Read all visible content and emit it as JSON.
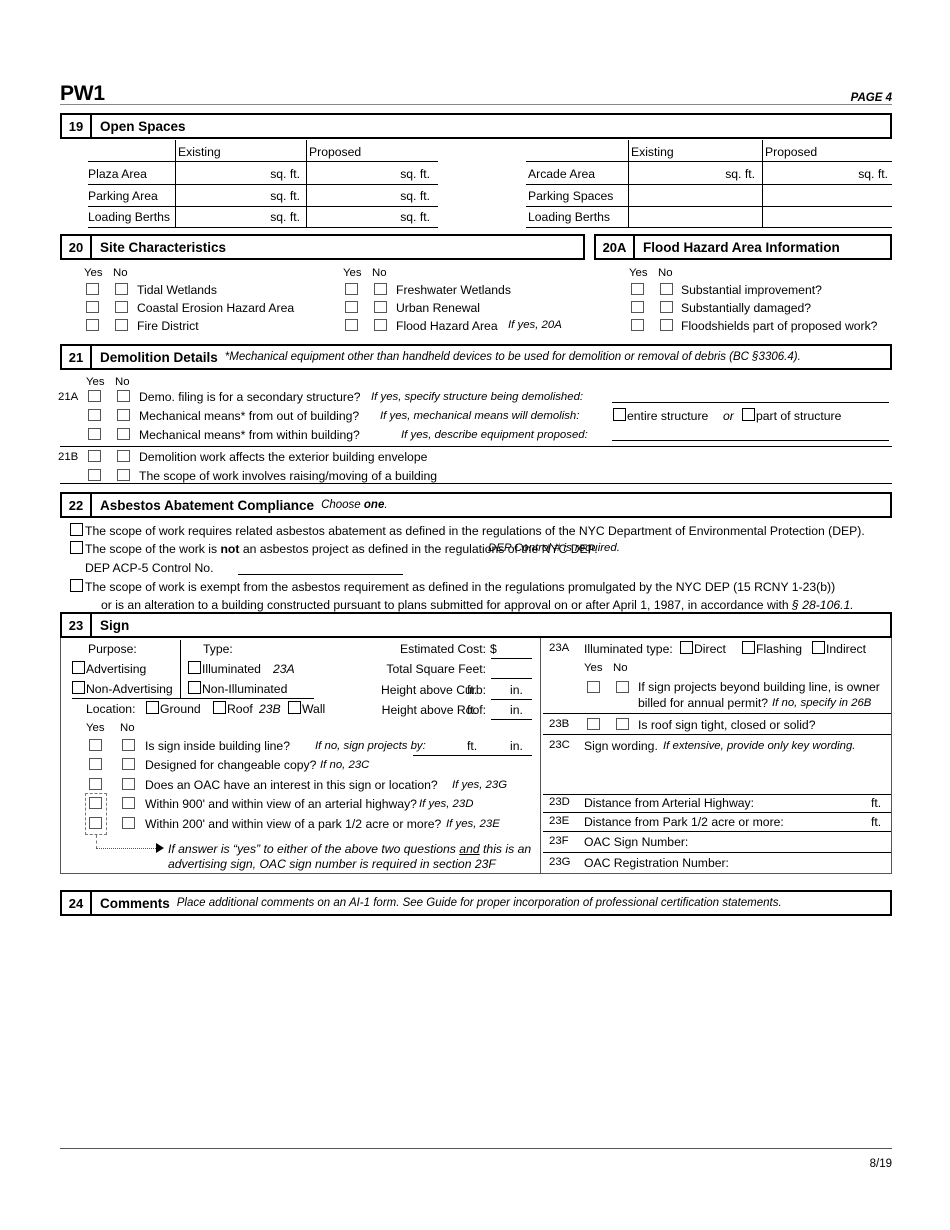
{
  "header": {
    "form_name": "PW1",
    "page_label": "PAGE 4"
  },
  "footer": {
    "revision": "8/19"
  },
  "section19": {
    "number": "19",
    "title": "Open Spaces",
    "left_table": {
      "columns": [
        "",
        "Existing",
        "Proposed"
      ],
      "rows": [
        {
          "label": "Plaza Area",
          "existing_unit": "sq. ft.",
          "proposed_unit": "sq. ft."
        },
        {
          "label": "Parking Area",
          "existing_unit": "sq. ft.",
          "proposed_unit": "sq. ft."
        },
        {
          "label": "Loading Berths",
          "existing_unit": "sq. ft.",
          "proposed_unit": "sq. ft."
        }
      ]
    },
    "right_table": {
      "columns": [
        "",
        "Existing",
        "Proposed"
      ],
      "rows": [
        {
          "label": "Arcade Area",
          "existing_unit": "sq. ft.",
          "proposed_unit": "sq. ft."
        },
        {
          "label": "Parking Spaces",
          "existing_unit": "",
          "proposed_unit": ""
        },
        {
          "label": "Loading Berths",
          "existing_unit": "",
          "proposed_unit": ""
        }
      ]
    }
  },
  "section20": {
    "number": "20",
    "title": "Site Characteristics",
    "yes_label": "Yes",
    "no_label": "No",
    "left_items": [
      {
        "label": "Tidal Wetlands"
      },
      {
        "label": "Coastal Erosion Hazard Area"
      },
      {
        "label": "Fire District"
      }
    ],
    "right_items": [
      {
        "label": "Freshwater Wetlands",
        "note": ""
      },
      {
        "label": "Urban Renewal",
        "note": ""
      },
      {
        "label": "Flood Hazard Area",
        "note": "If yes, 20A"
      }
    ]
  },
  "section20A": {
    "number": "20A",
    "title": "Flood Hazard Area Information",
    "yes_label": "Yes",
    "no_label": "No",
    "items": [
      {
        "label": "Substantial improvement?"
      },
      {
        "label": "Substantially damaged?"
      },
      {
        "label": "Floodshields part of proposed work?"
      }
    ]
  },
  "section21": {
    "number": "21",
    "title": "Demolition Details",
    "title_note": "*Mechanical equipment other than handheld devices to be used for demolition or removal of debris (BC §3306.4).",
    "yes_label": "Yes",
    "no_label": "No",
    "sub_21A": "21A",
    "sub_21B": "21B",
    "rows": [
      {
        "label": "Demo. filing is for a secondary structure?",
        "note": "If yes, specify structure being demolished:"
      },
      {
        "label": "Mechanical means* from out of building?",
        "note": "If yes, mechanical means will demolish:",
        "opt1": "entire structure",
        "or": "or",
        "opt2": "part of structure"
      },
      {
        "label": "Mechanical means* from within building?",
        "note": "If yes, describe equipment proposed:"
      },
      {
        "label": "Demolition work affects the exterior building envelope",
        "note": ""
      },
      {
        "label": "The scope of work involves raising/moving of a building",
        "note": ""
      }
    ]
  },
  "section22": {
    "number": "22",
    "title": "Asbestos Abatement Compliance",
    "title_note_pre": "Choose ",
    "title_note_bold": "one",
    "title_note_post": ".",
    "option1": "The scope of work requires related asbestos abatement as defined in the regulations of the NYC Department of Environmental Protection (DEP).",
    "option2_pre": "The scope of the work is ",
    "option2_bold": "not",
    "option2_post": " an asbestos project as defined in the regulations of the NYC DEP.",
    "option2_italic": "DEP Control # is required.",
    "acp5_label": "DEP ACP-5 Control No.",
    "acp5_value": "",
    "option3_line1": "The scope of work is exempt from the asbestos requirement as defined in the regulations promulgated by the NYC DEP (15 RCNY 1-23(b))",
    "option3_line2_pre": "or is an alteration  to a building constructed pursuant to plans submitted for approval on or after April 1, 1987, in accordance with ",
    "option3_line2_italic": "§ 28-106.1."
  },
  "section23": {
    "number": "23",
    "title": "Sign",
    "purpose_label": "Purpose:",
    "purpose_options": [
      "Advertising",
      "Non-Advertising"
    ],
    "type_label": "Type:",
    "type_options": [
      "Illuminated",
      "Non-Illuminated"
    ],
    "type_option1_ref": "23A",
    "location_label": "Location:",
    "location_options": [
      "Ground",
      "Roof",
      "Wall"
    ],
    "location_roof_ref": "23B",
    "fields": [
      {
        "label": "Estimated Cost:",
        "prefix": "$",
        "value": "",
        "unit1": "",
        "unit2": ""
      },
      {
        "label": "Total Square Feet:",
        "prefix": "",
        "value": "",
        "unit1": "",
        "unit2": ""
      },
      {
        "label": "Height above Curb:",
        "prefix": "",
        "value": "",
        "unit1": "ft.",
        "unit2": "in."
      },
      {
        "label": "Height above Roof:",
        "prefix": "",
        "value": "",
        "unit1": "ft.",
        "unit2": "in."
      }
    ],
    "yes_label": "Yes",
    "no_label": "No",
    "questions": [
      {
        "label": "Is sign inside building line?",
        "note": "If no, sign projects by:",
        "unit1": "ft.",
        "unit2": "in."
      },
      {
        "label": "Designed for changeable copy?",
        "note": "If no, 23C"
      },
      {
        "label": "Does an OAC have an interest in this sign or location?",
        "note": "If yes, 23G"
      },
      {
        "label": "Within 900' and within view of an arterial highway?",
        "note": "If yes, 23D"
      },
      {
        "label": "Within 200' and within view of a park 1/2 acre or more?",
        "note": "If yes, 23E"
      }
    ],
    "callout_line1_a": "If answer is “yes” to either of the above two questions ",
    "callout_line1_and": "and",
    "callout_line1_b": " this is an",
    "callout_line2": "advertising sign, OAC sign number is required in section 23F",
    "sub23A": {
      "number": "23A",
      "label": "Illuminated type:",
      "options": [
        "Direct",
        "Flashing",
        "Indirect"
      ],
      "yes_label": "Yes",
      "no_label": "No",
      "question_line1": "If sign projects beyond building line, is owner",
      "question_line2": "billed for annual permit?",
      "question_note": "If no, specify in 26B"
    },
    "sub23B": {
      "number": "23B",
      "label": "Is roof sign tight, closed or solid?"
    },
    "sub23C": {
      "number": "23C",
      "label": "Sign wording.",
      "note": "If extensive, provide only key wording.",
      "value": ""
    },
    "sub23D": {
      "number": "23D",
      "label": "Distance from Arterial Highway:",
      "unit": "ft.",
      "value": ""
    },
    "sub23E": {
      "number": "23E",
      "label": "Distance from Park 1/2 acre or more:",
      "unit": "ft.",
      "value": ""
    },
    "sub23F": {
      "number": "23F",
      "label": "OAC Sign Number:",
      "value": ""
    },
    "sub23G": {
      "number": "23G",
      "label": "OAC Registration Number:",
      "value": ""
    }
  },
  "section24": {
    "number": "24",
    "title": "Comments",
    "note": "Place additional comments on an AI-1 form.  See Guide for proper incorporation of professional certification statements."
  }
}
